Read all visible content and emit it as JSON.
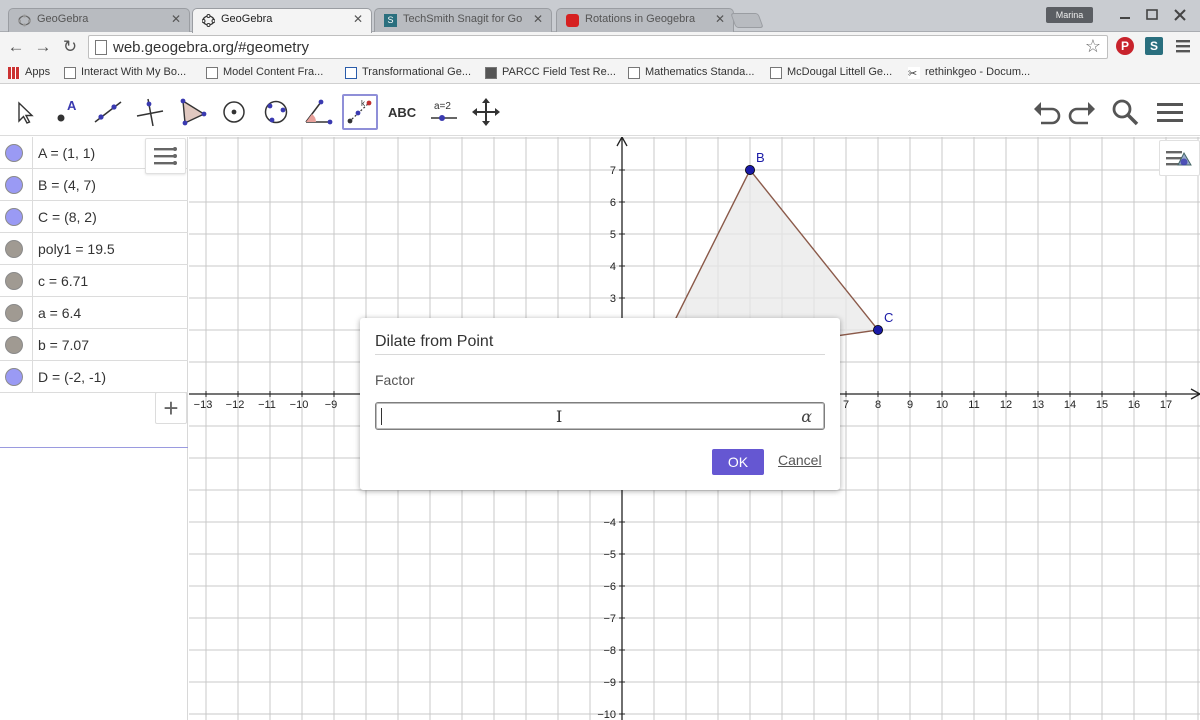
{
  "browser": {
    "tabs": [
      {
        "title": "GeoGebra",
        "active": false
      },
      {
        "title": "GeoGebra",
        "active": true
      },
      {
        "title": "TechSmith Snagit for Go",
        "active": false
      },
      {
        "title": "Rotations in Geogebra",
        "active": false
      }
    ],
    "user_badge": "Marina",
    "url": "web.geogebra.org/#geometry",
    "bookmarks": [
      "Apps",
      "Interact With My Bo...",
      "Model Content Fra...",
      "Transformational Ge...",
      "PARCC Field Test Re...",
      "Mathematics Standa...",
      "McDougal Littell Ge...",
      "rethinkgeo - Docum..."
    ]
  },
  "toolbar": {
    "tools": [
      "move-tool",
      "point-tool",
      "line-tool",
      "perpendicular-line-tool",
      "polygon-tool",
      "circle-tool",
      "ellipse-tool",
      "angle-tool",
      "dilate-tool",
      "text-tool",
      "slider-tool",
      "move-graphics-tool"
    ],
    "text_tool_label": "ABC",
    "slider_tool_label": "a=2",
    "dilate_tool_label": "k"
  },
  "algebra": {
    "items": [
      {
        "expr": "A = (1, 1)",
        "color": "#9a9af4"
      },
      {
        "expr": "B = (4, 7)",
        "color": "#9a9af4"
      },
      {
        "expr": "C = (8, 2)",
        "color": "#9a9af4"
      },
      {
        "expr": "poly1 = 19.5",
        "color": "#a09a92"
      },
      {
        "expr": "c = 6.71",
        "color": "#a09a92"
      },
      {
        "expr": "a = 6.4",
        "color": "#a09a92"
      },
      {
        "expr": "b = 7.07",
        "color": "#a09a92"
      },
      {
        "expr": "D = (-2, -1)",
        "color": "#9a9af4"
      }
    ],
    "add_label": "+"
  },
  "graphics": {
    "x_range": [
      -13,
      17
    ],
    "y_range": [
      -10,
      7
    ],
    "x_ticks": [
      -13,
      -12,
      -11,
      -10,
      -9,
      7,
      8,
      9,
      10,
      11,
      12,
      13,
      14,
      15,
      16,
      17
    ],
    "y_ticks_top": [
      7,
      6,
      5,
      4,
      3
    ],
    "y_ticks_bottom": [
      -4,
      -5,
      -6,
      -7,
      -8,
      -9,
      -10
    ],
    "points": [
      {
        "label": "B",
        "x": 4,
        "y": 7
      },
      {
        "label": "C",
        "x": 8,
        "y": 2
      }
    ],
    "polygon": [
      [
        1,
        1
      ],
      [
        4,
        7
      ],
      [
        8,
        2
      ]
    ],
    "point_color": "#1a1aa6",
    "polygon_stroke": "#8b5a4a",
    "polygon_fill": "#e8e8e8"
  },
  "dialog": {
    "title": "Dilate from Point",
    "factor_label": "Factor",
    "input_value": "",
    "alpha_symbol": "α",
    "ok_label": "OK",
    "cancel_label": "Cancel"
  },
  "colors": {
    "accent": "#6557d2",
    "grid": "#c8c8c8",
    "axis": "#222222"
  }
}
